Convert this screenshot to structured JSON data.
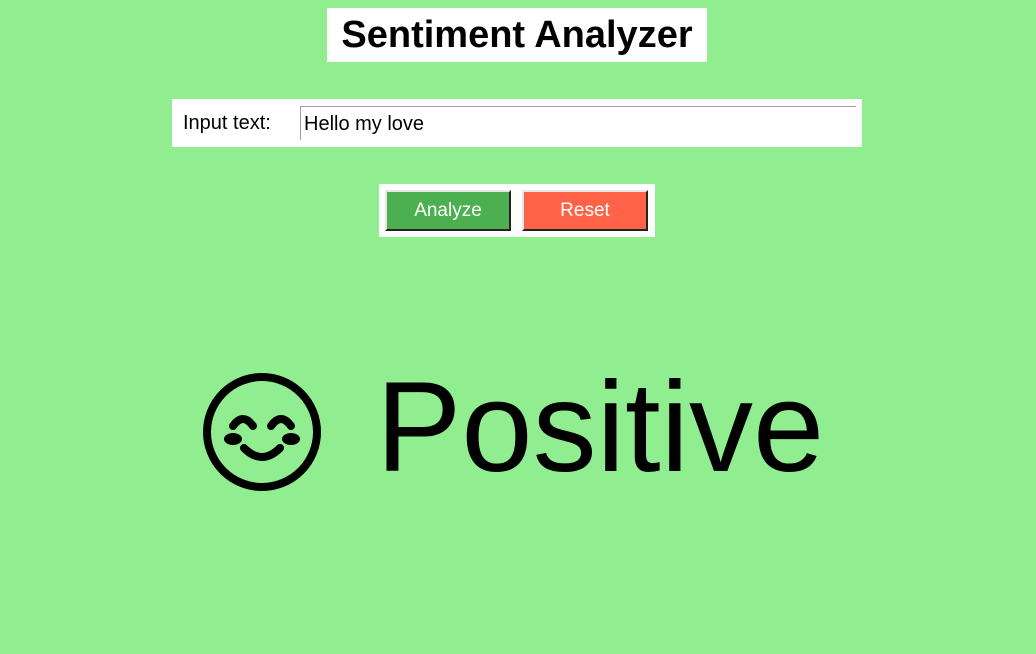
{
  "app": {
    "title": "Sentiment Analyzer"
  },
  "input": {
    "label": "Input text:",
    "value": "Hello my love"
  },
  "buttons": {
    "analyze_label": "Analyze",
    "reset_label": "Reset"
  },
  "result": {
    "icon": "smiling-face-icon",
    "label": "Positive"
  },
  "colors": {
    "background": "#90ee90",
    "analyze_button": "#4caf50",
    "reset_button": "#ff6347"
  }
}
